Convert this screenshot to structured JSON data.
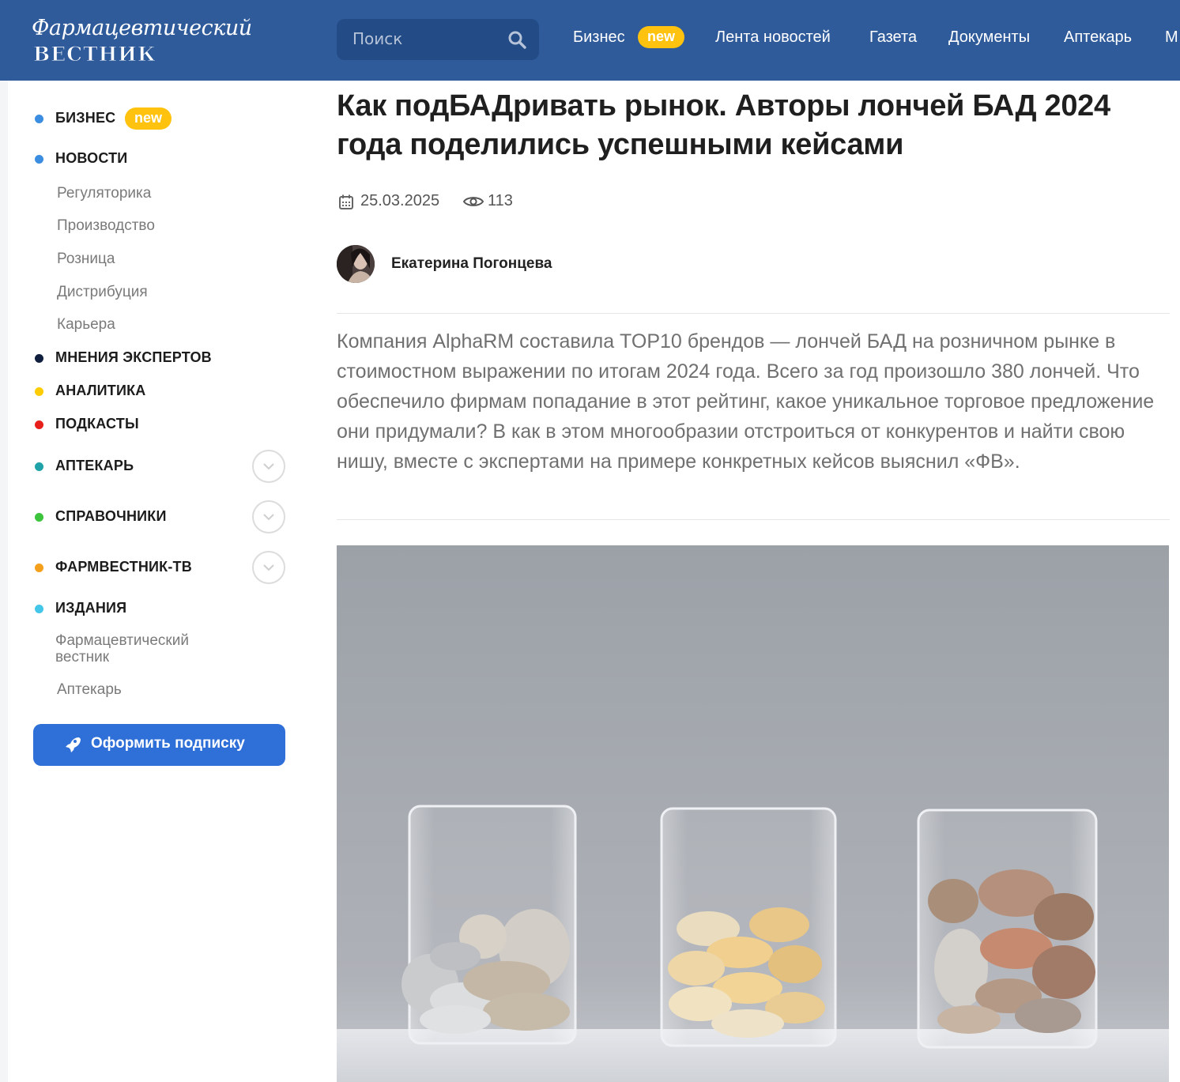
{
  "header": {
    "logo_top": "Фармацевтический",
    "logo_bottom": "ВЕСТНИК",
    "search_placeholder": "Поиск",
    "nav": [
      {
        "label": "Бизнес",
        "badge": "new"
      },
      {
        "label": "Лента новостей"
      },
      {
        "label": "Газета"
      },
      {
        "label": "Документы"
      },
      {
        "label": "Аптекарь"
      },
      {
        "label": "М"
      }
    ]
  },
  "sidebar": {
    "sections": [
      {
        "label": "БИЗНЕС",
        "badge": "new",
        "dot_color": "#3a8de0"
      },
      {
        "label": "НОВОСТИ",
        "dot_color": "#3a8de0"
      },
      {
        "label": "МНЕНИЯ ЭКСПЕРТОВ",
        "dot_color": "#111f3f"
      },
      {
        "label": "АНАЛИТИКА",
        "dot_color": "#ffcc00"
      },
      {
        "label": "ПОДКАСТЫ",
        "dot_color": "#e8201c"
      },
      {
        "label": "АПТЕКАРЬ",
        "dot_color": "#1fa3a8",
        "expandable": true
      },
      {
        "label": "СПРАВОЧНИКИ",
        "dot_color": "#3cc43c",
        "expandable": true
      },
      {
        "label": "ФАРМВЕСТНИК-ТВ",
        "dot_color": "#f5a01c",
        "expandable": true
      },
      {
        "label": "ИЗДАНИЯ",
        "dot_color": "#43c6e8"
      }
    ],
    "news_subitems": [
      "Регуляторика",
      "Производство",
      "Розница",
      "Дистрибуция",
      "Карьера"
    ],
    "editions_subitems": [
      "Фармацевтический вестник",
      "Аптекарь"
    ],
    "subscribe_label": "Оформить подписку"
  },
  "article": {
    "title": "Как подБАДривать рынок. Авторы лончей БАД 2024 года поделились успешными кейсами",
    "date": "25.03.2025",
    "views": "113",
    "author": "Екатерина Погонцева",
    "lead": "Компания AlphaRM составила TOP10 брендов — лончей БАД на розничном рынке в стоимостном выражении по итогам 2024 года. Всего за год произошло 380 лончей. Что обеспечило фирмам попадание в этот рейтинг, какое уникальное торговое предложение они придумали? В как в этом многообразии отстроиться от конкурентов и найти свою нишу, вместе с экспертами на примере конкретных кейсов выяснил «ФВ»."
  },
  "colors": {
    "header_bg": "#2f5b9b",
    "badge": "#ffc20e",
    "subscribe_button": "#2f6fd8"
  }
}
